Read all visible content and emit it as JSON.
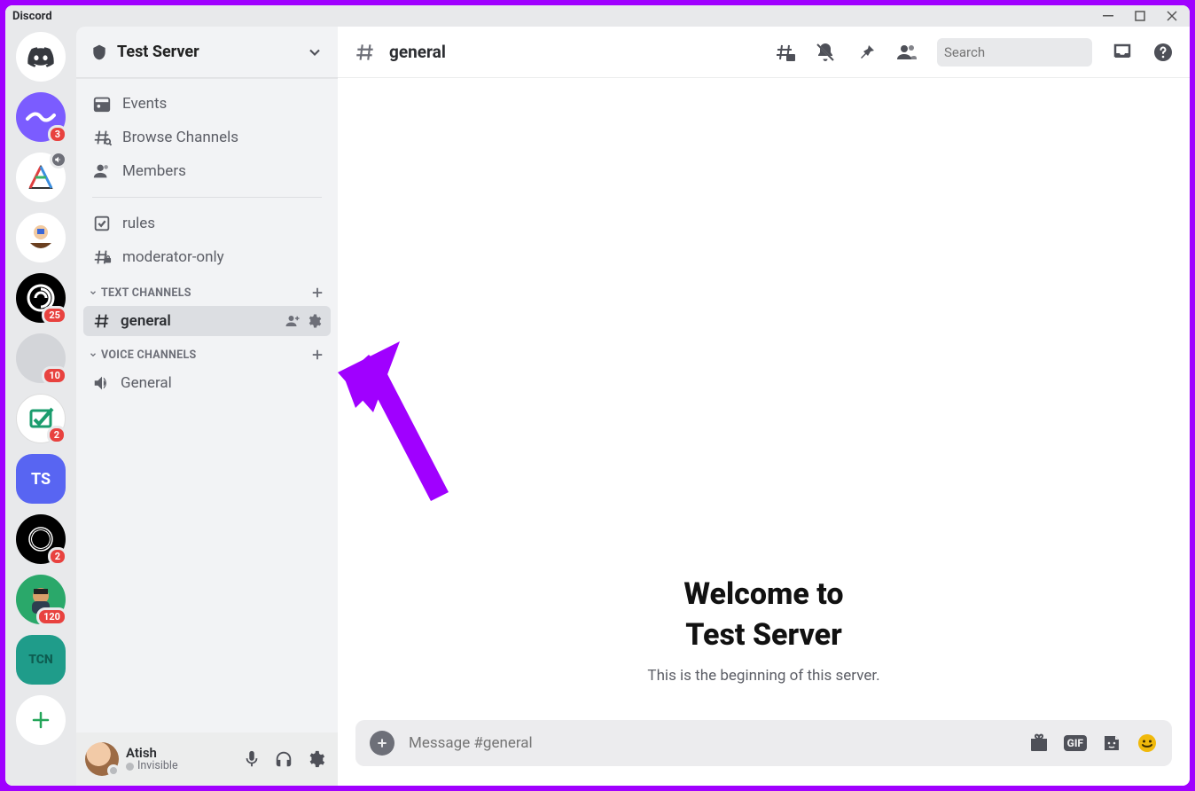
{
  "titlebar": {
    "app_name": "Discord"
  },
  "rail": {
    "servers": [
      {
        "id": "home",
        "selected": true
      },
      {
        "id": "s1",
        "bg": "#7b5cff",
        "badge": "3"
      },
      {
        "id": "s2",
        "bg": "#ffffff",
        "voice": true
      },
      {
        "id": "s3",
        "bg": "#ffffff"
      },
      {
        "id": "s4",
        "bg": "#000000",
        "badge": "25"
      },
      {
        "id": "s5",
        "bg": "#d3d5d9",
        "badge": "10"
      },
      {
        "id": "s6",
        "bg": "#ffffff",
        "badge": "2"
      },
      {
        "id": "s7",
        "bg": "#5865f2",
        "label": "TS"
      },
      {
        "id": "s8",
        "bg": "#000000",
        "badge": "2"
      },
      {
        "id": "s9",
        "bg": "#2aa86a",
        "badge": "120"
      },
      {
        "id": "s10",
        "bg": "#1f9c8a",
        "label": "TCN"
      }
    ]
  },
  "server": {
    "name": "Test Server",
    "nav": {
      "events": "Events",
      "browse": "Browse Channels",
      "members": "Members"
    },
    "top_channels": {
      "rules": "rules",
      "mod": "moderator-only"
    },
    "cat_text": "TEXT CHANNELS",
    "cat_voice": "VOICE CHANNELS",
    "text_channels": {
      "general": "general"
    },
    "voice_channels": {
      "general": "General"
    }
  },
  "user": {
    "name": "Atish",
    "status": "Invisible"
  },
  "topbar": {
    "channel": "general",
    "search_placeholder": "Search"
  },
  "welcome": {
    "line1": "Welcome to",
    "line2": "Test Server",
    "subtitle": "This is the beginning of this server."
  },
  "composer": {
    "placeholder": "Message #general"
  }
}
